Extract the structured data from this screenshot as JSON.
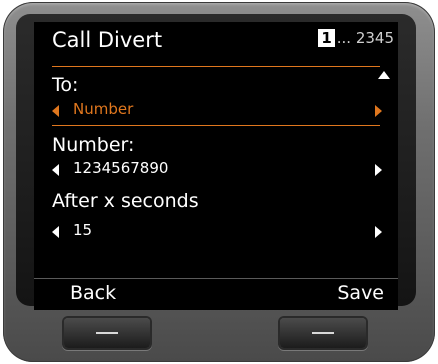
{
  "screen": {
    "title": "Call Divert",
    "page_indicator": {
      "current": "1",
      "rest": "... 2345"
    }
  },
  "fields": [
    {
      "label": "To:",
      "value": "Number",
      "active": true
    },
    {
      "label": "Number:",
      "value": "1234567890",
      "active": false
    },
    {
      "label": "After x seconds",
      "value": "15",
      "active": false
    }
  ],
  "softkeys": {
    "left_label": "Back",
    "right_label": "Save"
  },
  "icons": {
    "scroll": "scroll-up-icon",
    "prev": "arrow-left-icon",
    "next": "arrow-right-icon",
    "hardkey": "softkey-bar-icon"
  },
  "colors": {
    "accent": "#e0771e",
    "screen_background": "#000000",
    "text": "#ffffff",
    "device_body": "#6f6f6f"
  }
}
